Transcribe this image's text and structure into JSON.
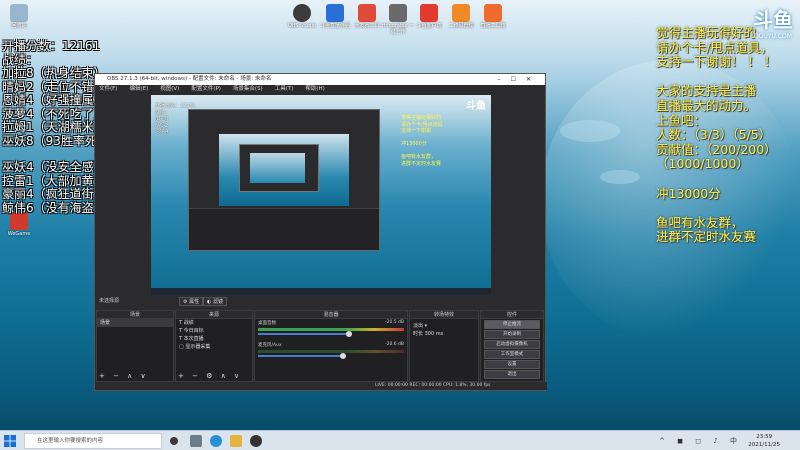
{
  "desktop": {
    "icons_top": [
      {
        "label": "OBS Studio",
        "color": "#3b3b3b"
      },
      {
        "label": "斗鱼直播伴侣",
        "color": "#2a6fd6"
      },
      {
        "label": "水友赛工具",
        "color": "#e04a3a"
      },
      {
        "label": "Honorable 一键上传",
        "color": "#6a6a6a"
      },
      {
        "label": "斗鱼客户端",
        "color": "#e23b2e"
      },
      {
        "label": "二维码管理",
        "color": "#f08a24"
      },
      {
        "label": "直播工具箱",
        "color": "#ef6c2e"
      }
    ],
    "icons_left": [
      {
        "label": "回收站",
        "color": "#9ab6cf"
      },
      {
        "label": "WeGame",
        "color": "#d0392b"
      }
    ]
  },
  "overlay_left": {
    "lines": [
      "开播分数：12161",
      "战绩：",
      "加拉8（热身结束）",
      "晴妈2（走位不错）",
      "恩婧4（好强撞属）",
      "菠萝4（不死吃了）",
      "拉姆1（天湖糯米）",
      "巫妖8（93胜率死）",
      "",
      "巫妖4（没安全感）",
      "控雷1（大部加黄）",
      "豪丽4（疯狂道街）",
      "鲸伟6（没有海盗）"
    ]
  },
  "overlay_right": {
    "lines": [
      "觉得主播玩得好的",
      "请办个卡/甩点道具，",
      "支持一下谢谢！ ！ ！",
      "",
      "大家的支持是主播",
      "直播最大的动力。",
      "上鱼吧：",
      "人数：（3/3）（5/5）",
      "贡献值：（200/200）",
      "（1000/1000）",
      "",
      "冲13000分",
      "",
      "鱼吧有水友群，",
      "进群不定时水友赛"
    ]
  },
  "logo": {
    "text": "斗鱼",
    "sub": "DOUYU.COM"
  },
  "obs": {
    "title": "OBS 27.1.3 (64-bit, windows) - 配置文件: 未命名 - 场景: 未命名",
    "menu": [
      "文件(F)",
      "编辑(E)",
      "视图(V)",
      "配置文件(P)",
      "场景集合(S)",
      "工具(T)",
      "帮助(H)"
    ],
    "source_bar_label": "未选择源",
    "tab_properties": "属性",
    "tab_filters": "滤镜",
    "scenes": {
      "header": "场景",
      "items": [
        "场景"
      ]
    },
    "sources": {
      "header": "来源",
      "items": [
        "战绩",
        "今日目标",
        "本次直播",
        "显示器采集"
      ]
    },
    "mixer": {
      "header": "混音器",
      "tracks": [
        {
          "name": "桌面音频",
          "db": "-20.5 dB",
          "level": 0.62
        },
        {
          "name": "麦克风/Aux",
          "db": "-20.6 dB",
          "level": 0.58
        }
      ]
    },
    "transitions": {
      "header": "转场特效",
      "value": "淡出",
      "duration_label": "时长",
      "duration": "300 ms"
    },
    "controls": {
      "header": "控件",
      "buttons": [
        "停止推流",
        "开始录制",
        "启动虚拟摄像机",
        "工作室模式",
        "设置",
        "退出"
      ]
    },
    "status": "LIVE: 00:00:00   REC: 00:00:00   CPU: 1.8%, 30.00 fps",
    "preview_mini": {
      "left": [
        "开播分数：12161",
        "战绩：",
        "加拉8",
        "晴妈2",
        "恩婧4"
      ],
      "right": [
        "觉得主播玩得好的",
        "请办个卡/甩点道具",
        "支持一下谢谢",
        "",
        "冲13000分",
        "",
        "鱼吧有水友群，",
        "进群不定时水友赛"
      ]
    }
  },
  "taskbar": {
    "search_placeholder": "在这里输入你要搜索的内容",
    "time": "23:59",
    "date": "2021/11/25",
    "tray_icons": "^ ◼ ◻ ♪ 中"
  }
}
